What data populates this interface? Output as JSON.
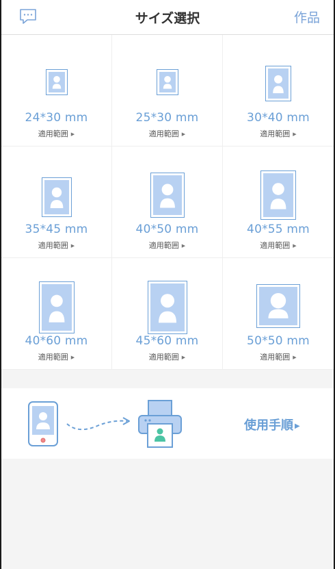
{
  "header": {
    "title": "サイズ選択",
    "works_label": "作品",
    "message_icon": "chat-bubble-icon"
  },
  "sizes": [
    {
      "label": "24*30 mm",
      "range": "適用範囲"
    },
    {
      "label": "25*30 mm",
      "range": "適用範囲"
    },
    {
      "label": "30*40 mm",
      "range": "適用範囲"
    },
    {
      "label": "35*45 mm",
      "range": "適用範囲"
    },
    {
      "label": "40*50 mm",
      "range": "適用範囲"
    },
    {
      "label": "40*55 mm",
      "range": "適用範囲"
    },
    {
      "label": "40*60 mm",
      "range": "適用範囲"
    },
    {
      "label": "45*60 mm",
      "range": "適用範囲"
    },
    {
      "label": "50*50 mm",
      "range": "適用範囲"
    }
  ],
  "guide": {
    "label": "使用手順",
    "icons": [
      "phone-icon",
      "dashed-arrow-icon",
      "printer-icon"
    ]
  },
  "colors": {
    "accent": "#6a9fd6",
    "photo_fill": "#b8d1f2",
    "background": "#f4f4f4"
  }
}
